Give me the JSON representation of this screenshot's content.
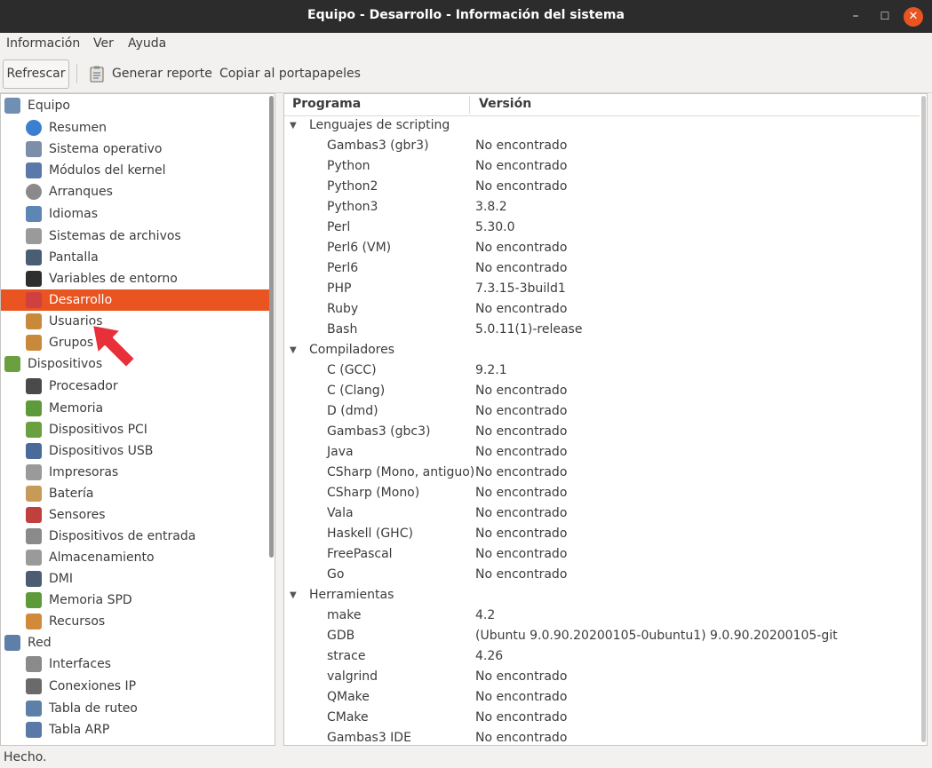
{
  "window": {
    "title": "Equipo - Desarrollo - Información del sistema",
    "controls": [
      "minimize-icon",
      "maximize-icon",
      "close-icon"
    ]
  },
  "menu": {
    "items": [
      "Información",
      "Ver",
      "Ayuda"
    ]
  },
  "toolbar": {
    "refresh_label": "Refrescar",
    "report_label": "Generar reporte",
    "copy_label": "Copiar al portapapeles"
  },
  "tree": {
    "items": [
      {
        "label": "Equipo",
        "level": 0,
        "icon": "computer-icon",
        "color": "#6f8fb3"
      },
      {
        "label": "Resumen",
        "level": 1,
        "icon": "info-icon",
        "color": "#3b7fd0"
      },
      {
        "label": "Sistema operativo",
        "level": 1,
        "icon": "gear-icon",
        "color": "#7b8fa8"
      },
      {
        "label": "Módulos del kernel",
        "level": 1,
        "icon": "module-icon",
        "color": "#5a78a8"
      },
      {
        "label": "Arranques",
        "level": 1,
        "icon": "power-icon",
        "color": "#8a8a8a"
      },
      {
        "label": "Idiomas",
        "level": 1,
        "icon": "language-icon",
        "color": "#5d85b5"
      },
      {
        "label": "Sistemas de archivos",
        "level": 1,
        "icon": "drive-icon",
        "color": "#9a9a9a"
      },
      {
        "label": "Pantalla",
        "level": 1,
        "icon": "monitor-icon",
        "color": "#4b5d73"
      },
      {
        "label": "Variables de entorno",
        "level": 1,
        "icon": "terminal-icon",
        "color": "#2e2e2e"
      },
      {
        "label": "Desarrollo",
        "level": 1,
        "icon": "development-icon",
        "color": "#d04040",
        "selected": true
      },
      {
        "label": "Usuarios",
        "level": 1,
        "icon": "users-icon",
        "color": "#c88a3a"
      },
      {
        "label": "Grupos",
        "level": 1,
        "icon": "groups-icon",
        "color": "#c88a3a"
      },
      {
        "label": "Dispositivos",
        "level": 0,
        "icon": "devices-icon",
        "color": "#6aa040"
      },
      {
        "label": "Procesador",
        "level": 1,
        "icon": "cpu-icon",
        "color": "#4a4a4a"
      },
      {
        "label": "Memoria",
        "level": 1,
        "icon": "memory-icon",
        "color": "#5d9a3a"
      },
      {
        "label": "Dispositivos PCI",
        "level": 1,
        "icon": "pci-icon",
        "color": "#6aa040"
      },
      {
        "label": "Dispositivos USB",
        "level": 1,
        "icon": "usb-icon",
        "color": "#4a6a9a"
      },
      {
        "label": "Impresoras",
        "level": 1,
        "icon": "printer-icon",
        "color": "#9a9a9a"
      },
      {
        "label": "Batería",
        "level": 1,
        "icon": "battery-icon",
        "color": "#c89a5a"
      },
      {
        "label": "Sensores",
        "level": 1,
        "icon": "thermometer-icon",
        "color": "#c04040"
      },
      {
        "label": "Dispositivos de entrada",
        "level": 1,
        "icon": "input-device-icon",
        "color": "#8a8a8a"
      },
      {
        "label": "Almacenamiento",
        "level": 1,
        "icon": "storage-icon",
        "color": "#9a9a9a"
      },
      {
        "label": "DMI",
        "level": 1,
        "icon": "dmi-icon",
        "color": "#4b5d73"
      },
      {
        "label": "Memoria SPD",
        "level": 1,
        "icon": "spd-icon",
        "color": "#5d9a3a"
      },
      {
        "label": "Recursos",
        "level": 1,
        "icon": "resources-icon",
        "color": "#d08a3a"
      },
      {
        "label": "Red",
        "level": 0,
        "icon": "network-icon",
        "color": "#5d7fa8"
      },
      {
        "label": "Interfaces",
        "level": 1,
        "icon": "interfaces-icon",
        "color": "#8a8a8a"
      },
      {
        "label": "Conexiones IP",
        "level": 1,
        "icon": "ip-connections-icon",
        "color": "#6a6a6a"
      },
      {
        "label": "Tabla de ruteo",
        "level": 1,
        "icon": "routing-icon",
        "color": "#5d7fa8"
      },
      {
        "label": "Tabla ARP",
        "level": 1,
        "icon": "arp-icon",
        "color": "#5a78a8"
      }
    ]
  },
  "table": {
    "columns": [
      "Programa",
      "Versión"
    ],
    "rows": [
      {
        "type": "category",
        "label": "Lenguajes de scripting"
      },
      {
        "type": "item",
        "program": "Gambas3 (gbr3)",
        "version": "No encontrado"
      },
      {
        "type": "item",
        "program": "Python",
        "version": "No encontrado"
      },
      {
        "type": "item",
        "program": "Python2",
        "version": "No encontrado"
      },
      {
        "type": "item",
        "program": "Python3",
        "version": "3.8.2"
      },
      {
        "type": "item",
        "program": "Perl",
        "version": "5.30.0"
      },
      {
        "type": "item",
        "program": "Perl6 (VM)",
        "version": "No encontrado"
      },
      {
        "type": "item",
        "program": "Perl6",
        "version": "No encontrado"
      },
      {
        "type": "item",
        "program": "PHP",
        "version": "7.3.15-3build1"
      },
      {
        "type": "item",
        "program": "Ruby",
        "version": "No encontrado"
      },
      {
        "type": "item",
        "program": "Bash",
        "version": "5.0.11(1)-release"
      },
      {
        "type": "category",
        "label": "Compiladores"
      },
      {
        "type": "item",
        "program": "C (GCC)",
        "version": "9.2.1"
      },
      {
        "type": "item",
        "program": "C (Clang)",
        "version": "No encontrado"
      },
      {
        "type": "item",
        "program": "D (dmd)",
        "version": "No encontrado"
      },
      {
        "type": "item",
        "program": "Gambas3 (gbc3)",
        "version": "No encontrado"
      },
      {
        "type": "item",
        "program": "Java",
        "version": "No encontrado"
      },
      {
        "type": "item",
        "program": "CSharp (Mono, antiguo)",
        "version": "No encontrado"
      },
      {
        "type": "item",
        "program": "CSharp (Mono)",
        "version": "No encontrado"
      },
      {
        "type": "item",
        "program": "Vala",
        "version": "No encontrado"
      },
      {
        "type": "item",
        "program": "Haskell (GHC)",
        "version": "No encontrado"
      },
      {
        "type": "item",
        "program": "FreePascal",
        "version": "No encontrado"
      },
      {
        "type": "item",
        "program": "Go",
        "version": "No encontrado"
      },
      {
        "type": "category",
        "label": "Herramientas"
      },
      {
        "type": "item",
        "program": "make",
        "version": "4.2"
      },
      {
        "type": "item",
        "program": "GDB",
        "version": "(Ubuntu 9.0.90.20200105-0ubuntu1) 9.0.90.20200105-git"
      },
      {
        "type": "item",
        "program": "strace",
        "version": "4.26"
      },
      {
        "type": "item",
        "program": "valgrind",
        "version": "No encontrado"
      },
      {
        "type": "item",
        "program": "QMake",
        "version": "No encontrado"
      },
      {
        "type": "item",
        "program": "CMake",
        "version": "No encontrado"
      },
      {
        "type": "item",
        "program": "Gambas3 IDE",
        "version": "No encontrado"
      }
    ]
  },
  "status": {
    "text": "Hecho."
  },
  "colors": {
    "accent": "#e95420",
    "titlebar": "#2c2c2c",
    "annotation_arrow": "#e8303a"
  }
}
